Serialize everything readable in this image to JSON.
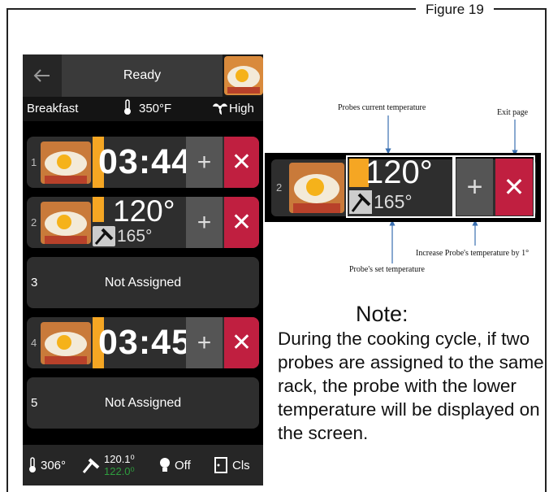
{
  "figure": {
    "title": "Figure 19"
  },
  "phone": {
    "status": "Ready",
    "recipe_name": "Breakfast",
    "oven_temp": "350°F",
    "fan_speed": "High",
    "racks": [
      {
        "num": "1",
        "state": "timer",
        "time": "03:44",
        "progress": 0.5
      },
      {
        "num": "2",
        "state": "probe",
        "current_temp": "120°",
        "set_temp": "165°"
      },
      {
        "num": "3",
        "state": "empty",
        "label": "Not Assigned"
      },
      {
        "num": "4",
        "state": "timer",
        "time": "03:45",
        "progress": 0.5
      },
      {
        "num": "5",
        "state": "empty",
        "label": "Not Assigned"
      }
    ],
    "bottom": {
      "cavity_temp": "306°",
      "probe_current": "120.1⁰",
      "probe_target": "122.0⁰",
      "light": "Off",
      "door": "Cls"
    }
  },
  "zoom": {
    "rack_num": "2",
    "current_temp": "120°",
    "set_temp": "165°",
    "labels": {
      "current": "Probes current temperature",
      "exit": "Exit page",
      "increase": "Increase Probe's temperature by 1°",
      "set": "Probe's set temperature"
    }
  },
  "note": {
    "heading": "Note:",
    "body": "During the cooking cycle, if two probes are assigned to the same rack, the probe with the lower temperature will be displayed on the screen."
  },
  "colors": {
    "accent": "#f5a623",
    "delete": "#c01f40",
    "target_green": "#2e9e3e"
  }
}
